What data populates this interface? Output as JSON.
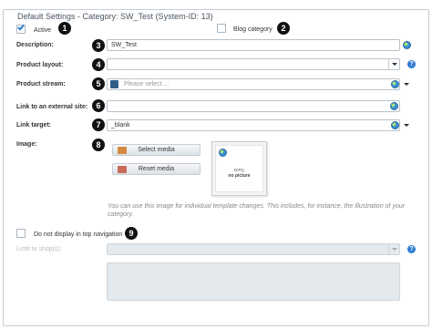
{
  "legend": "Default Settings - Category: SW_Test (System-ID: 13)",
  "active": {
    "label": "Active",
    "checked": true
  },
  "blog_category": {
    "label": "Blog category",
    "checked": false
  },
  "description": {
    "label": "Description:",
    "value": "SW_Test"
  },
  "product_layout": {
    "label": "Product layout:",
    "value": ""
  },
  "product_stream": {
    "label": "Product stream:",
    "placeholder": "Please select ..."
  },
  "external_link": {
    "label": "Link to an external site:",
    "value": ""
  },
  "link_target": {
    "label": "Link target:",
    "value": "_blank"
  },
  "image": {
    "label": "Image:",
    "select_media": "Select media",
    "reset_media": "Reset media",
    "preview_line1": "sorry,",
    "preview_line2": "no picture",
    "note": "You can use this image for individual template changes. This includes, for instance, the illustration of your category."
  },
  "hide_top_nav": {
    "label": "Do not display in top navigation",
    "checked": false
  },
  "limit_shops": {
    "label": "Limit to shop(s):",
    "value": ""
  },
  "markers": [
    "1",
    "2",
    "3",
    "4",
    "5",
    "6",
    "7",
    "8",
    "9"
  ],
  "help_glyph": "?",
  "colors": {
    "accent": "#2f7bd0",
    "marker": "#111111",
    "border": "#b9c3cc"
  }
}
